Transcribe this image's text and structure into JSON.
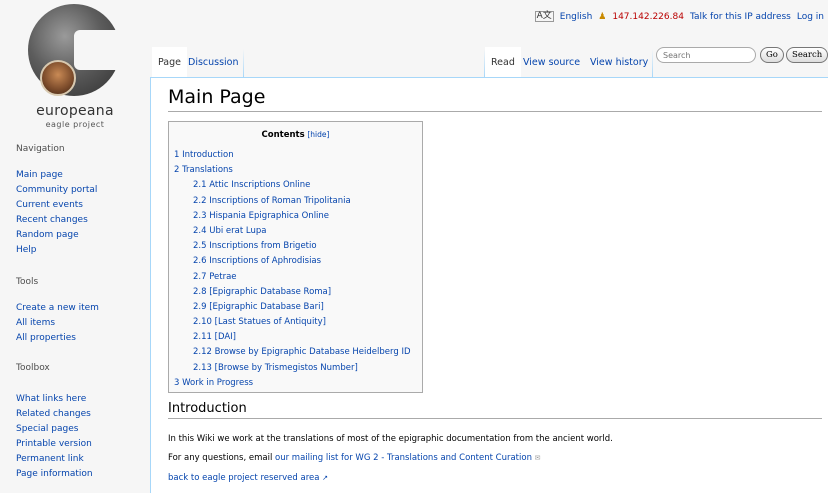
{
  "logo": {
    "wordmark": "europeana",
    "subtitle": "eagle project"
  },
  "personal": {
    "language": "English",
    "ip": "147.142.226.84",
    "talk": "Talk for this IP address",
    "login": "Log in"
  },
  "tabs": {
    "page": "Page",
    "discussion": "Discussion",
    "read": "Read",
    "view_source": "View source",
    "view_history": "View history"
  },
  "search": {
    "placeholder": "Search",
    "go": "Go",
    "search": "Search"
  },
  "sidebar": {
    "navigation": {
      "heading": "Navigation",
      "items": [
        "Main page",
        "Community portal",
        "Current events",
        "Recent changes",
        "Random page",
        "Help"
      ]
    },
    "tools": {
      "heading": "Tools",
      "items": [
        "Create a new item",
        "All items",
        "All properties"
      ]
    },
    "toolbox": {
      "heading": "Toolbox",
      "items": [
        "What links here",
        "Related changes",
        "Special pages",
        "Printable version",
        "Permanent link",
        "Page information"
      ]
    }
  },
  "content": {
    "title": "Main Page",
    "toc": {
      "title": "Contents",
      "hide": "[hide]",
      "items": [
        {
          "text": "1 Introduction",
          "level": 1
        },
        {
          "text": "2 Translations",
          "level": 1
        },
        {
          "text": "2.1 Attic Inscriptions Online",
          "level": 2
        },
        {
          "text": "2.2 Inscriptions of Roman Tripolitania",
          "level": 2
        },
        {
          "text": "2.3 Hispania Epigraphica Online",
          "level": 2
        },
        {
          "text": "2.4 Ubi erat Lupa",
          "level": 2
        },
        {
          "text": "2.5 Inscriptions from Brigetio",
          "level": 2
        },
        {
          "text": "2.6 Inscriptions of Aphrodisias",
          "level": 2
        },
        {
          "text": "2.7 Petrae",
          "level": 2
        },
        {
          "text": "2.8 [Epigraphic Database Roma]",
          "level": 2
        },
        {
          "text": "2.9 [Epigraphic Database Bari]",
          "level": 2
        },
        {
          "text": "2.10 [Last Statues of Antiquity]",
          "level": 2
        },
        {
          "text": "2.11 [DAI]",
          "level": 2
        },
        {
          "text": "2.12 Browse by Epigraphic Database Heidelberg ID",
          "level": 2
        },
        {
          "text": "2.13 [Browse by Trismegistos Number]",
          "level": 2
        },
        {
          "text": "3 Work in Progress",
          "level": 1
        }
      ]
    },
    "intro_heading": "Introduction",
    "para1": "In this Wiki we work at the translations of most of the epigraphic documentation from the ancient world.",
    "para2_prefix": "For any questions, email ",
    "para2_link": "our mailing list for WG 2 - Translations and Content Curation",
    "para3_link": "back to eagle project reserved area"
  },
  "colors": {
    "link": "#0645ad",
    "ip": "#ba0000",
    "border": "#a7d7f9"
  }
}
